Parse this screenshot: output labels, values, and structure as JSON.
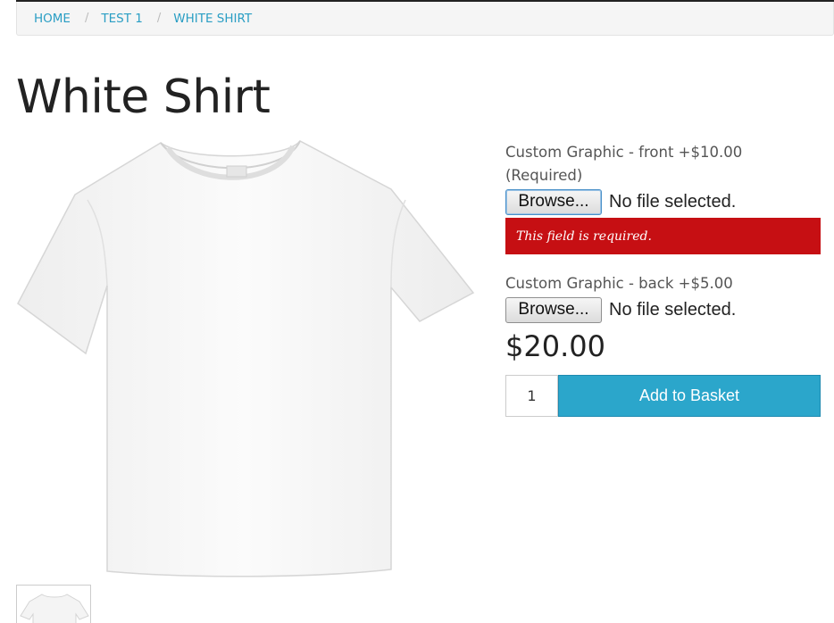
{
  "breadcrumb": {
    "items": [
      "HOME",
      "TEST 1",
      "WHITE SHIRT"
    ],
    "separator": "/"
  },
  "product": {
    "title": "White Shirt",
    "price": "$20.00",
    "image_icon": "tshirt-image",
    "thumbnail_icon": "tshirt-thumbnail"
  },
  "options": [
    {
      "label_line1": "Custom Graphic - front +$10.00",
      "label_line2": "(Required)",
      "browse_label": "Browse...",
      "file_status": "No file selected.",
      "error": "This field is required."
    },
    {
      "label_line1": "Custom Graphic - back +$5.00",
      "browse_label": "Browse...",
      "file_status": "No file selected."
    }
  ],
  "cart": {
    "quantity": "1",
    "add_label": "Add to Basket"
  },
  "colors": {
    "link": "#2a9ec4",
    "error_bg": "#c60f13",
    "button_bg": "#2ba6cb"
  }
}
